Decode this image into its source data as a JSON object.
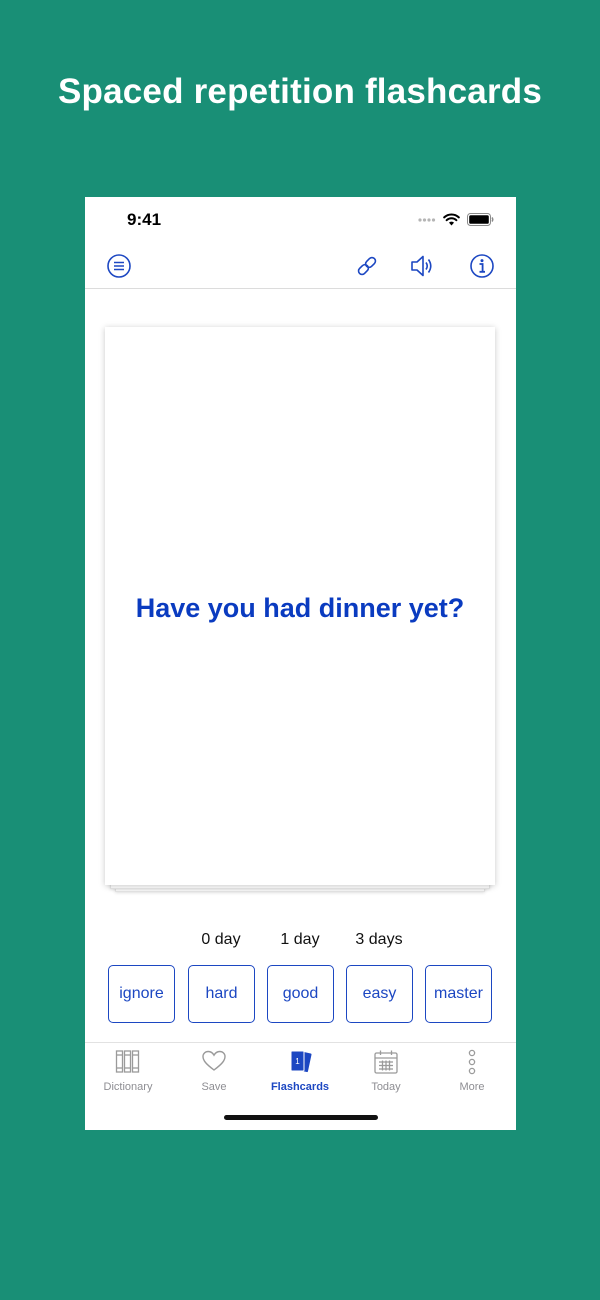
{
  "headline": "Spaced repetition flashcards",
  "status_bar": {
    "time": "9:41"
  },
  "nav_bar": {
    "menu_icon": "menu-icon",
    "link_icon": "link-icon",
    "speaker_icon": "speaker-icon",
    "info_icon": "info-icon"
  },
  "card": {
    "text": "Have you had dinner yet?"
  },
  "intervals": [
    "0 day",
    "1 day",
    "3 days"
  ],
  "grade_buttons": [
    "ignore",
    "hard",
    "good",
    "easy",
    "master"
  ],
  "tab_bar": {
    "active": "Flashcards",
    "tabs": [
      {
        "label": "Dictionary",
        "icon": "books-icon"
      },
      {
        "label": "Save",
        "icon": "heart-icon"
      },
      {
        "label": "Flashcards",
        "icon": "flashcards-icon",
        "badge": "1"
      },
      {
        "label": "Today",
        "icon": "calendar-icon"
      },
      {
        "label": "More",
        "icon": "more-dots-icon"
      }
    ]
  },
  "colors": {
    "background": "#198f76",
    "accent": "#1c47c2",
    "card_text": "#0a3bc0",
    "tab_inactive": "#8e8e93"
  }
}
